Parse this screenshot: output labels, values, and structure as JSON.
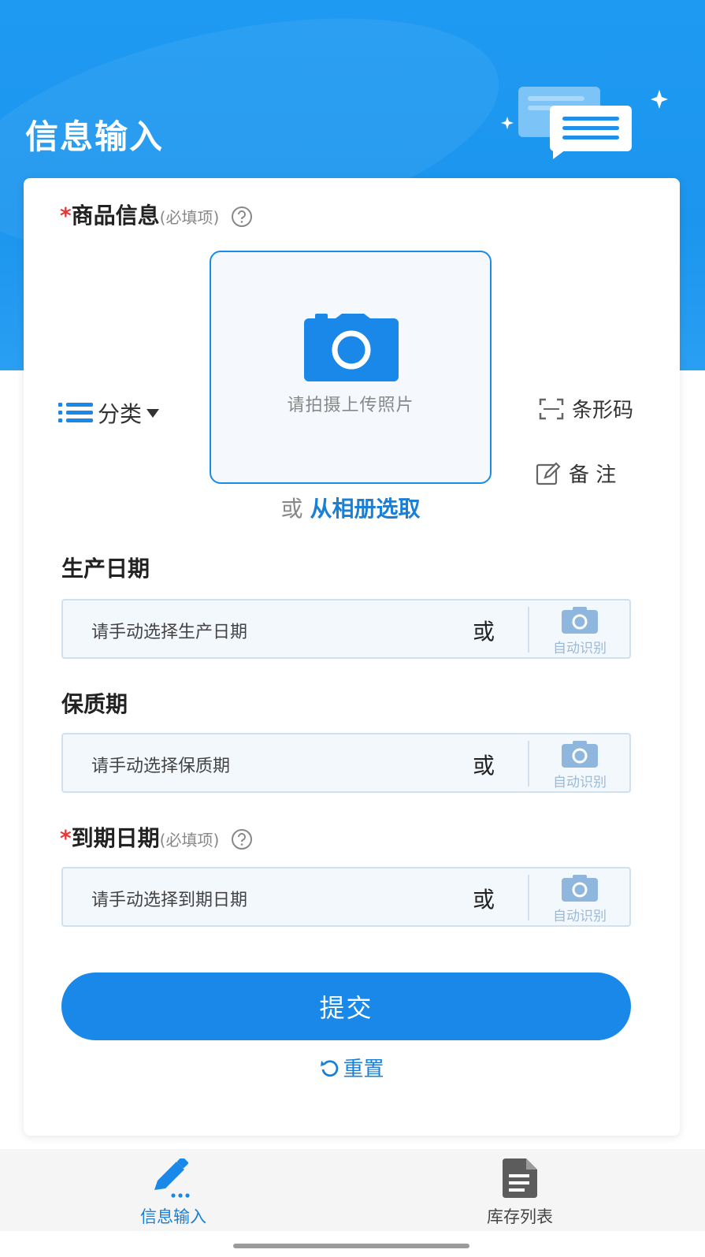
{
  "header": {
    "title": "信息输入"
  },
  "product": {
    "required_mark": "*",
    "title": "商品信息",
    "hint": "(必填项)",
    "category_label": "分类",
    "upload_text": "请拍摄上传照片",
    "album_or": "或",
    "album_link": "从相册选取",
    "barcode_label": "条形码",
    "note_label": "备 注"
  },
  "production_date": {
    "title": "生产日期",
    "placeholder": "请手动选择生产日期",
    "or": "或",
    "auto_label": "自动识别"
  },
  "shelf_life": {
    "title": "保质期",
    "placeholder": "请手动选择保质期",
    "or": "或",
    "auto_label": "自动识别"
  },
  "expiry_date": {
    "required_mark": "*",
    "title": "到期日期",
    "hint": "(必填项)",
    "placeholder": "请手动选择到期日期",
    "or": "或",
    "auto_label": "自动识别"
  },
  "actions": {
    "submit_label": "提交",
    "reset_label": "重置"
  },
  "tabbar": {
    "tabs": [
      {
        "label": "信息输入",
        "icon": "edit-icon",
        "active": true
      },
      {
        "label": "库存列表",
        "icon": "document-icon",
        "active": false
      }
    ]
  },
  "colors": {
    "primary": "#1a88e8",
    "link": "#1a7fd6",
    "required": "#e23a3a",
    "field_bg": "#f3f8fd"
  }
}
